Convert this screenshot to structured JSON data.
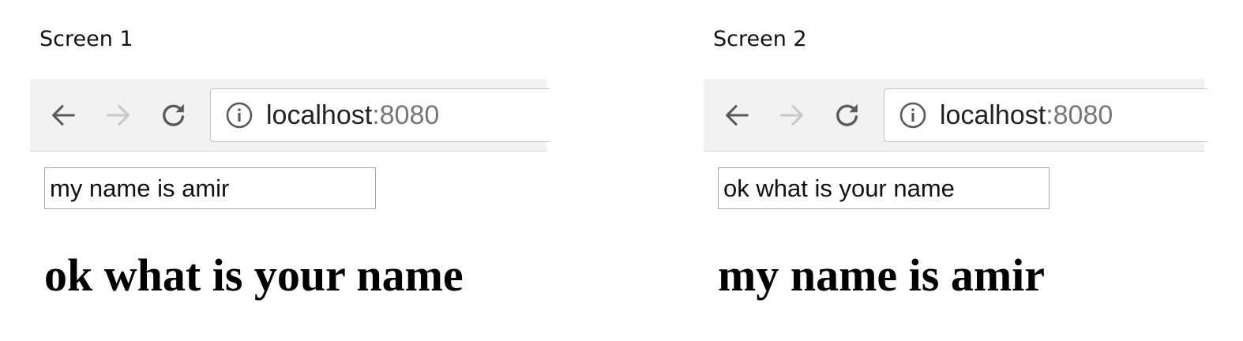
{
  "screens": [
    {
      "label": "Screen 1",
      "url": {
        "host": "localhost",
        "port": ":8080"
      },
      "input_value": "my name is amir",
      "heading": "ok what is your name"
    },
    {
      "label": "Screen 2",
      "url": {
        "host": "localhost",
        "port": ":8080"
      },
      "input_value": "ok what is your name",
      "heading": "my name is amir"
    }
  ],
  "icons": {
    "back": "back-arrow-icon",
    "forward": "forward-arrow-icon",
    "reload": "reload-icon",
    "info": "info-icon"
  },
  "colors": {
    "toolbar_bg": "#f2f2f2",
    "icon_active": "#5a5a5a",
    "icon_disabled": "#c8c8c8",
    "port_text": "#777777"
  }
}
